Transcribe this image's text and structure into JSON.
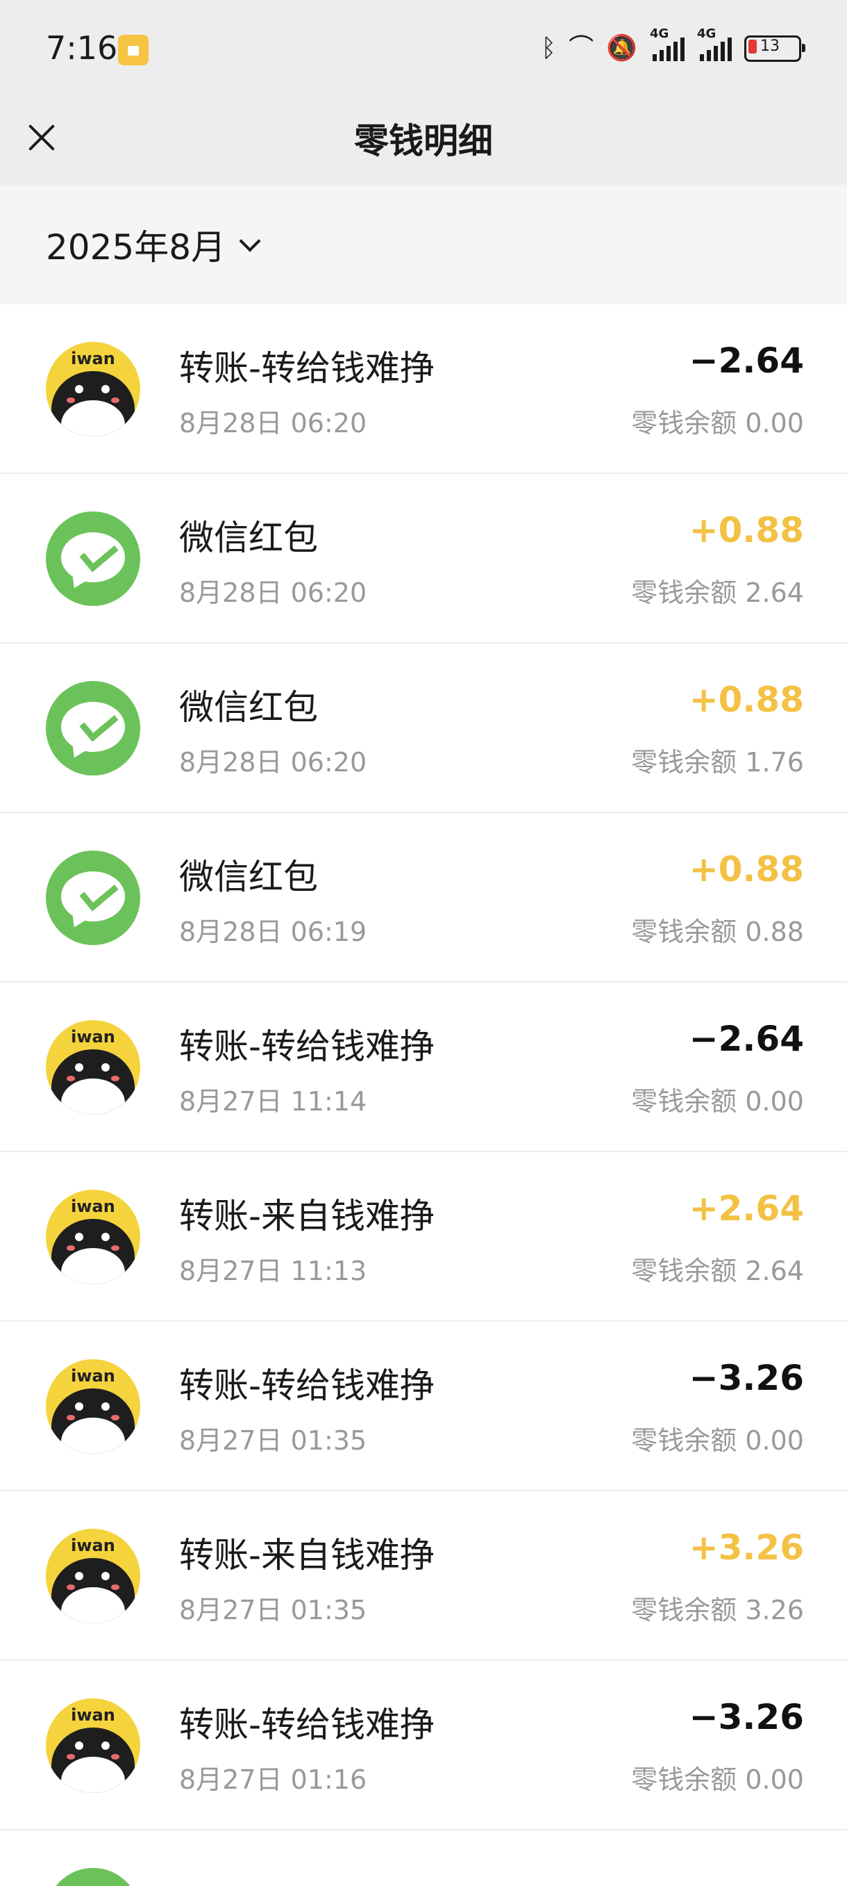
{
  "status_bar": {
    "time": "7:16",
    "battery": "13",
    "network_1": "4G",
    "network_2": "4G"
  },
  "nav": {
    "title": "零钱明细"
  },
  "filter": {
    "month": "2025年8月"
  },
  "balance_prefix": "零钱余额",
  "transactions": [
    {
      "icon": "iwan-avatar",
      "title": "转账-转给钱难挣",
      "time": "8月28日 06:20",
      "amount": "−2.64",
      "direction": "out",
      "balance": "零钱余额 0.00"
    },
    {
      "icon": "wechat-icon",
      "title": "微信红包",
      "time": "8月28日 06:20",
      "amount": "+0.88",
      "direction": "in",
      "balance": "零钱余额 2.64"
    },
    {
      "icon": "wechat-icon",
      "title": "微信红包",
      "time": "8月28日 06:20",
      "amount": "+0.88",
      "direction": "in",
      "balance": "零钱余额 1.76"
    },
    {
      "icon": "wechat-icon",
      "title": "微信红包",
      "time": "8月28日 06:19",
      "amount": "+0.88",
      "direction": "in",
      "balance": "零钱余额 0.88"
    },
    {
      "icon": "iwan-avatar",
      "title": "转账-转给钱难挣",
      "time": "8月27日 11:14",
      "amount": "−2.64",
      "direction": "out",
      "balance": "零钱余额 0.00"
    },
    {
      "icon": "iwan-avatar",
      "title": "转账-来自钱难挣",
      "time": "8月27日 11:13",
      "amount": "+2.64",
      "direction": "in",
      "balance": "零钱余额 2.64"
    },
    {
      "icon": "iwan-avatar",
      "title": "转账-转给钱难挣",
      "time": "8月27日 01:35",
      "amount": "−3.26",
      "direction": "out",
      "balance": "零钱余额 0.00"
    },
    {
      "icon": "iwan-avatar",
      "title": "转账-来自钱难挣",
      "time": "8月27日 01:35",
      "amount": "+3.26",
      "direction": "in",
      "balance": "零钱余额 3.26"
    },
    {
      "icon": "iwan-avatar",
      "title": "转账-转给钱难挣",
      "time": "8月27日 01:16",
      "amount": "−3.26",
      "direction": "out",
      "balance": "零钱余额 0.00"
    }
  ],
  "colors": {
    "positive": "#f3c144",
    "negative": "#111111",
    "wechat_green": "#6cc25a",
    "iwan_yellow": "#f5d33d"
  }
}
